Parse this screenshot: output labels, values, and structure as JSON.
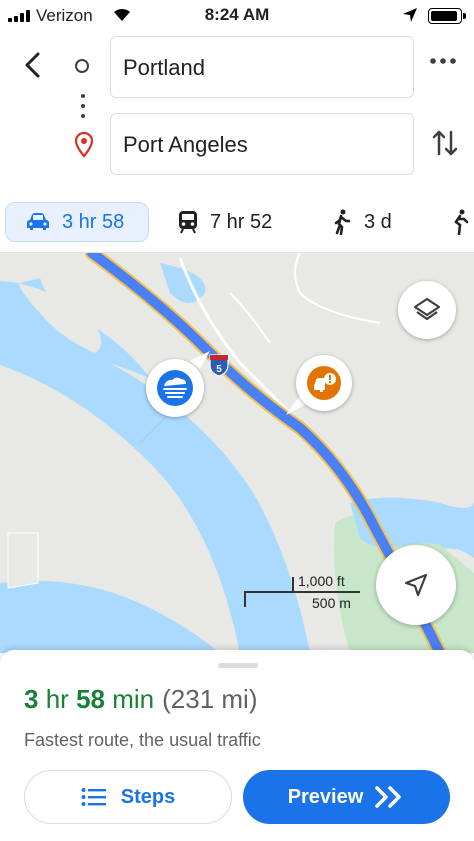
{
  "status_bar": {
    "carrier": "Verizon",
    "time": "8:24 AM"
  },
  "route": {
    "origin": "Portland",
    "destination": "Port Angeles"
  },
  "modes": [
    {
      "name": "driving",
      "icon": "car-icon",
      "duration": "3 hr 58",
      "selected": true
    },
    {
      "name": "transit",
      "icon": "train-icon",
      "duration": "7 hr 52",
      "selected": false
    },
    {
      "name": "walking",
      "icon": "walking-icon",
      "duration": "3 d",
      "selected": false
    },
    {
      "name": "cycling",
      "icon": "cycling-icon",
      "duration": "",
      "selected": false
    }
  ],
  "map": {
    "highway_shield": "5",
    "scale_imperial": "1,000 ft",
    "scale_metric": "500 m",
    "weather_callout_icon": "fog-icon",
    "incident_callout_icon": "traffic-incident-icon"
  },
  "summary": {
    "duration_hr": "3",
    "hr_unit": "hr",
    "duration_min": "58",
    "min_unit": "min",
    "distance": "(231 mi)",
    "description": "Fastest route, the usual traffic"
  },
  "actions": {
    "steps_label": "Steps",
    "preview_label": "Preview"
  },
  "colors": {
    "accent": "#1a73e8",
    "duration_green": "#188038",
    "route_blue": "#4a80f5",
    "water": "#aadaff",
    "incident_orange": "#e37400"
  }
}
